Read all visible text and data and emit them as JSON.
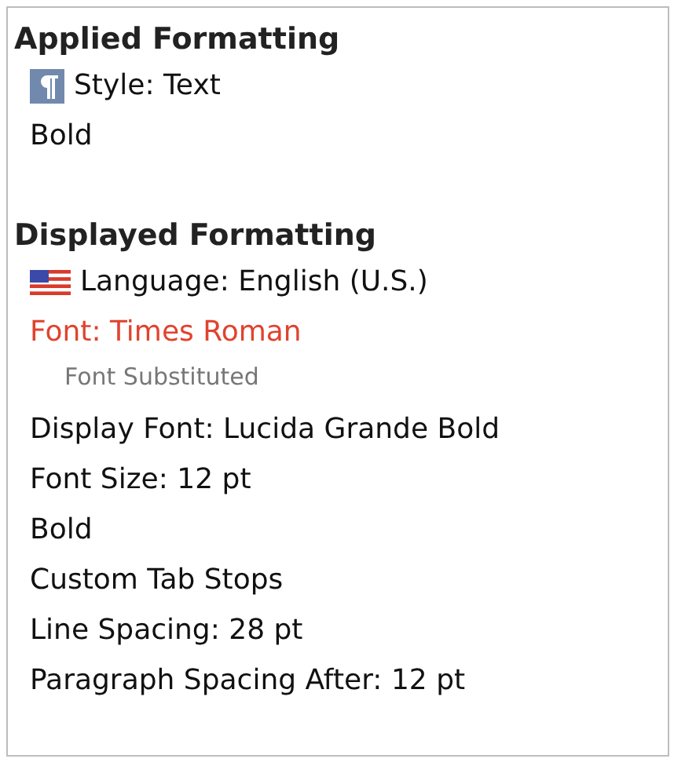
{
  "sections": [
    {
      "title": "Applied Formatting",
      "items": [
        {
          "kind": "style",
          "text": "Style: Text"
        },
        {
          "kind": "plain",
          "text": "Bold"
        }
      ]
    },
    {
      "title": "Displayed Formatting",
      "items": [
        {
          "kind": "language",
          "text": "Language: English (U.S.)"
        },
        {
          "kind": "warning",
          "text": "Font: Times Roman"
        },
        {
          "kind": "note",
          "text": "Font Substituted"
        },
        {
          "kind": "plain",
          "text": "Display Font: Lucida Grande Bold"
        },
        {
          "kind": "plain",
          "text": "Font Size: 12 pt"
        },
        {
          "kind": "plain",
          "text": "Bold"
        },
        {
          "kind": "plain",
          "text": "Custom Tab Stops"
        },
        {
          "kind": "plain",
          "text": "Line Spacing: 28 pt"
        },
        {
          "kind": "plain",
          "text": "Paragraph Spacing After: 12 pt"
        }
      ]
    }
  ]
}
